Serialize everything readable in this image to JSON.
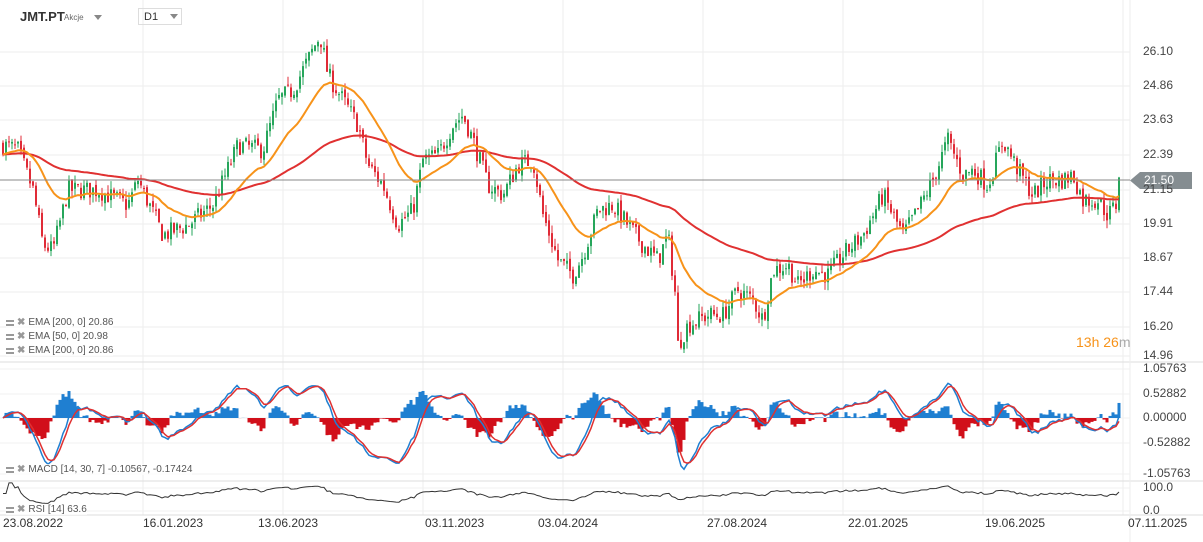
{
  "header": {
    "symbol": "JMT.PT",
    "asset_type": "Akcje",
    "timeframe": "D1"
  },
  "legends": {
    "ema1": "EMA [200,  0] 20.86",
    "ema2": "EMA [50,  0] 20.98",
    "ema3": "EMA [200,  0] 20.86",
    "macd": "MACD [14, 30, 7] -0.10567,  -0.17424",
    "rsi": "RSI [14]  63.6"
  },
  "current_price": "21.50",
  "timer": {
    "hours": "13h",
    "minutes": "26",
    "m": "m"
  },
  "colors": {
    "up": "#26a65b",
    "down": "#e02b37",
    "ema50": "#f7931a",
    "ema200": "#e03131",
    "macd": "#1f7fd1",
    "signal": "#e03131",
    "hist_pos": "#1f7fd1",
    "hist_neg": "#d10f1a"
  },
  "chart_data": {
    "type": "candlestick",
    "title": "JMT.PT D1",
    "price_ticks": [
      "26.10",
      "24.86",
      "23.63",
      "22.39",
      "21.15",
      "19.91",
      "18.67",
      "17.44",
      "16.20",
      "14.96"
    ],
    "macd_ticks": [
      "1.05763",
      "0.52882",
      "0.00000",
      "-0.52882",
      "-1.05763"
    ],
    "rsi_ticks": [
      "100.0",
      "0.0"
    ],
    "date_ticks": [
      "23.08.2022",
      "16.01.2023",
      "13.06.2023",
      "03.11.2023",
      "03.04.2024",
      "27.08.2024",
      "22.01.2025",
      "19.06.2025",
      "07.11.2025"
    ],
    "ylim": [
      14.96,
      26.1
    ],
    "close_approx": {
      "day": [
        2,
        17,
        32,
        42,
        52,
        67,
        97,
        127,
        137,
        162,
        187,
        212,
        237,
        262,
        277,
        292,
        307,
        319,
        327,
        342,
        357,
        367,
        382,
        397,
        412,
        422,
        437,
        452,
        462,
        472,
        487,
        502,
        517,
        532,
        542,
        557,
        572,
        582,
        597,
        612,
        627,
        642,
        657,
        667,
        675,
        677,
        687,
        707,
        722,
        737,
        752,
        762,
        772,
        787,
        797,
        812,
        827,
        842,
        862,
        882,
        892,
        902,
        917,
        932,
        947,
        962,
        972,
        987,
        1002,
        1017,
        1032,
        1047,
        1062,
        1072,
        1082,
        1097,
        1107,
        1115,
        1117
      ],
      "close": [
        22.69,
        22.51,
        21.04,
        19.03,
        18.84,
        21.04,
        21.04,
        20.49,
        21.41,
        19.39,
        19.76,
        20.49,
        22.69,
        22.51,
        24.34,
        24.71,
        25.81,
        26.72,
        25.26,
        24.34,
        23.43,
        21.96,
        21.23,
        19.76,
        20.31,
        22.14,
        22.33,
        23.43,
        23.79,
        22.88,
        21.23,
        20.86,
        21.96,
        22.14,
        20.13,
        18.48,
        17.93,
        18.66,
        20.31,
        20.49,
        19.76,
        19.03,
        18.48,
        19.39,
        17.01,
        15.36,
        16.1,
        16.46,
        16.46,
        17.38,
        17.01,
        16.28,
        18.11,
        18.29,
        17.56,
        18.11,
        17.93,
        18.66,
        19.39,
        20.86,
        20.13,
        19.39,
        20.31,
        21.41,
        22.88,
        21.59,
        21.78,
        21.23,
        22.88,
        21.78,
        20.86,
        21.41,
        21.41,
        21.59,
        20.68,
        20.68,
        20.13,
        20.49,
        21.5
      ]
    },
    "last": {
      "ema50": 20.98,
      "ema200": 20.86,
      "macd": -0.10567,
      "signal": -0.17424,
      "rsi": 63.6
    }
  }
}
